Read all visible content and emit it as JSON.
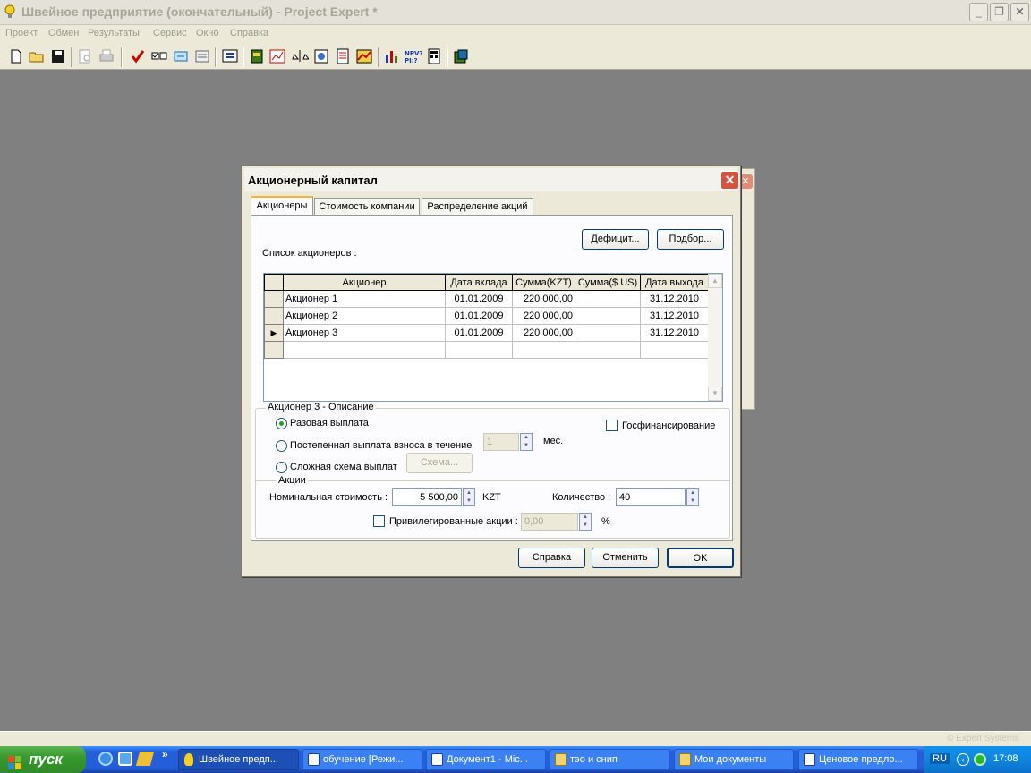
{
  "app": {
    "title": "Швейное предприятие (окончательный) - Project Expert *",
    "brand_watermark": "© Expert Systems"
  },
  "menu": [
    "Проект",
    "Обмен",
    "Результаты",
    "Сервис",
    "Окно",
    "Справка"
  ],
  "toolbar_icons": [
    "new-file-icon",
    "open-folder-icon",
    "save-icon",
    "print-preview-icon",
    "print-icon",
    "check-icon",
    "checklist-icon",
    "exchange-icon",
    "document-icon",
    "screen-icon",
    "calendar-icon",
    "cashflow-icon",
    "balance-icon",
    "globe-icon",
    "report-icon",
    "chart-icon",
    "bar-chart-icon",
    "npv-icon",
    "calculator-icon",
    "analysis-icon"
  ],
  "dialog": {
    "title": "Акционерный капитал",
    "tabs": [
      "Акционеры",
      "Стоимость компании",
      "Распределение акций"
    ],
    "buttons": {
      "deficit": "Дефицит...",
      "selection": "Подбор..."
    },
    "list_label": "Список акционеров :",
    "columns": [
      "Акционер",
      "Дата вклада",
      "Сумма(KZT)",
      "Сумма($ US)",
      "Дата выхода"
    ],
    "rows": [
      {
        "name": "Акционер 1",
        "date_in": "01.01.2009",
        "sum_kzt": "220 000,00",
        "sum_usd": "",
        "date_out": "31.12.2010"
      },
      {
        "name": "Акционер 2",
        "date_in": "01.01.2009",
        "sum_kzt": "220 000,00",
        "sum_usd": "",
        "date_out": "31.12.2010"
      },
      {
        "name": "Акционер 3",
        "date_in": "01.01.2009",
        "sum_kzt": "220 000,00",
        "sum_usd": "",
        "date_out": "31.12.2010"
      }
    ],
    "description": {
      "group_title": "Акционер 3 - Описание",
      "radio_single": "Разовая выплата",
      "radio_gradual": "Постепенная выплата взноса  в течение",
      "gradual_value": "1",
      "gradual_unit": "мес.",
      "radio_complex": "Сложная схема выплат",
      "scheme_button": "Схема...",
      "gov_funding": "Госфинансирование"
    },
    "shares": {
      "group_title": "Акции",
      "nominal_label": "Номинальная стоимость :",
      "nominal_value": "5 500,00",
      "nominal_unit": "KZT",
      "quantity_label": "Количество :",
      "quantity_value": "40",
      "preferred_label": "Привилегированные акции :",
      "preferred_value": "0,00",
      "preferred_unit": "%"
    },
    "footer": {
      "help": "Справка",
      "cancel": "Отменить",
      "ok": "OK"
    }
  },
  "taskbar": {
    "start": "пуск",
    "tasks": [
      "Швейное предп...",
      "обучение [Режи...",
      "Документ1 - Mic...",
      "тэо и снип",
      "Мои документы",
      "Ценовое предло..."
    ],
    "lang": "RU",
    "clock": "17:08"
  }
}
